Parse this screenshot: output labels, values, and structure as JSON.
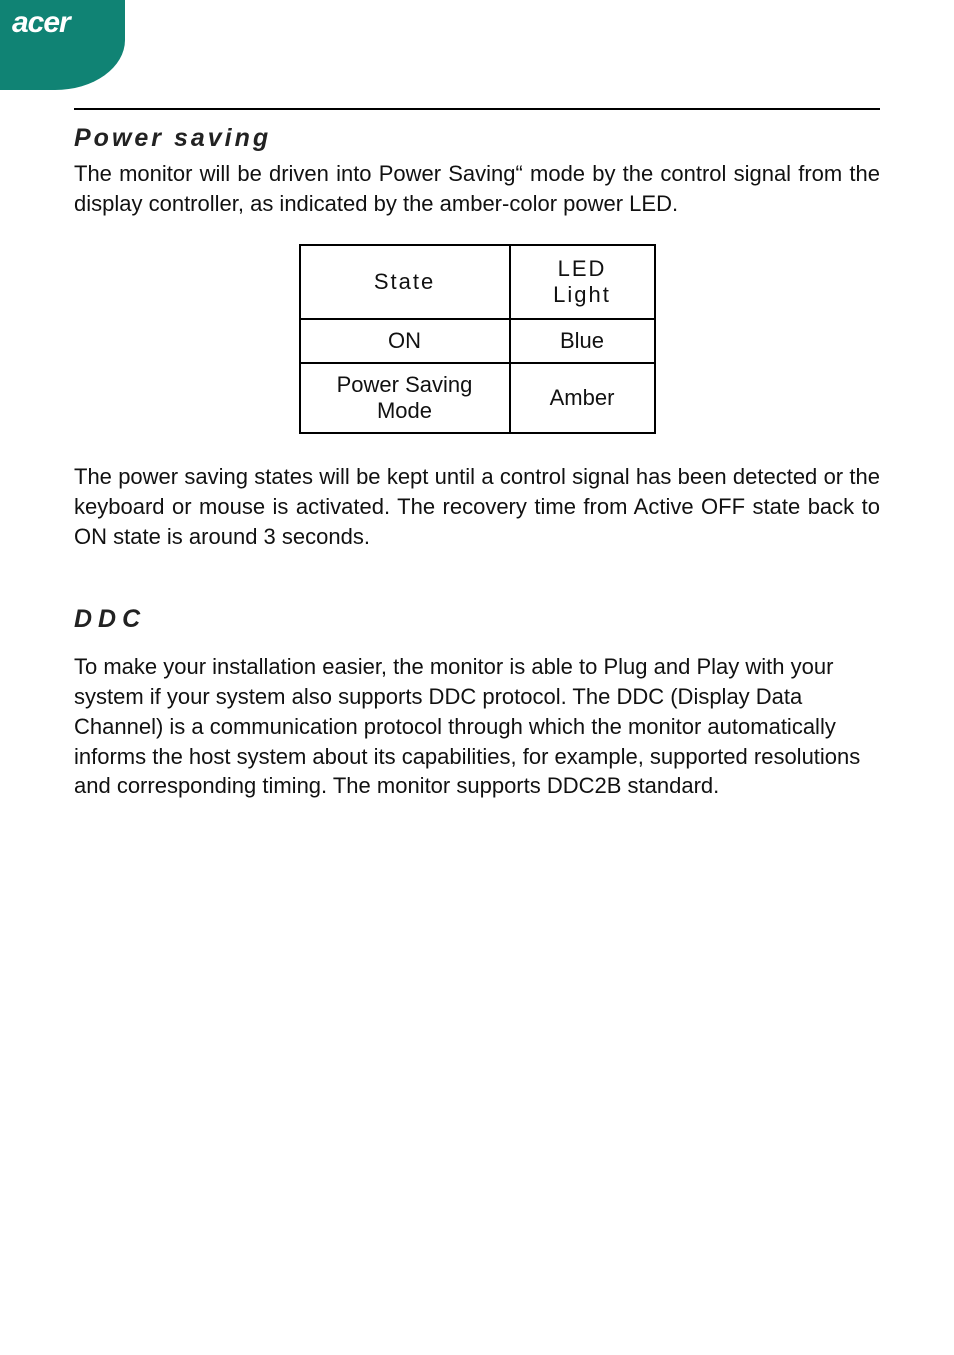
{
  "brand": "acer",
  "section1": {
    "title": "Power saving",
    "p1": "The monitor will be driven into Power Saving“ mode by the control signal from the display controller, as indicated by the amber-color power LED.",
    "p2": "The power saving states will be kept until a control signal has been detected or the keyboard or mouse is activated. The recovery time from Active OFF state back to ON state is around 3 seconds."
  },
  "chart_data": {
    "type": "table",
    "columns": [
      "State",
      "LED Light"
    ],
    "rows": [
      [
        "ON",
        "Blue"
      ],
      [
        "Power Saving Mode",
        "Amber"
      ]
    ]
  },
  "section2": {
    "title": "DDC",
    "p1": "To make your installation easier, the monitor is able to Plug and Play with your system if your system also supports DDC protocol. The DDC (Display Data Channel) is a communication protocol through which the monitor automatically informs the host system  about its capabilities, for example, supported resolutions and corresponding timing. The monitor supports DDC2B standard."
  }
}
